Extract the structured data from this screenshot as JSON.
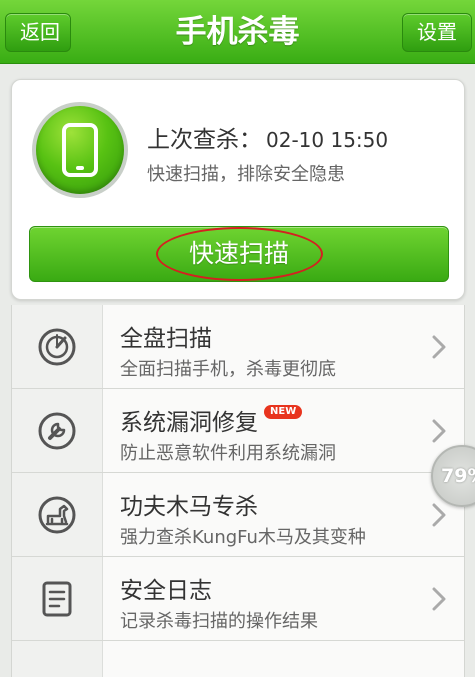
{
  "header": {
    "back_label": "返回",
    "title": "手机杀毒",
    "settings_label": "设置"
  },
  "status": {
    "last_scan_label": "上次查杀：",
    "last_scan_time": "02-10 15:50",
    "subtitle": "快速扫描，排除安全隐患",
    "quick_scan_label": "快速扫描"
  },
  "list": {
    "items": [
      {
        "title": "全盘扫描",
        "subtitle": "全面扫描手机，杀毒更彻底",
        "icon": "full-scan-icon"
      },
      {
        "title": "系统漏洞修复",
        "subtitle": "防止恶意软件利用系统漏洞",
        "icon": "wrench-icon",
        "badge": "NEW"
      },
      {
        "title": "功夫木马专杀",
        "subtitle": "强力查杀KungFu木马及其变种",
        "icon": "trojan-horse-icon"
      },
      {
        "title": "安全日志",
        "subtitle": "记录杀毒扫描的操作结果",
        "icon": "log-document-icon"
      }
    ]
  },
  "float_badge": {
    "percent": "79%"
  },
  "colors": {
    "brand_green": "#3aaa13",
    "new_badge": "#e8341e",
    "annotation_red": "#d42020"
  }
}
